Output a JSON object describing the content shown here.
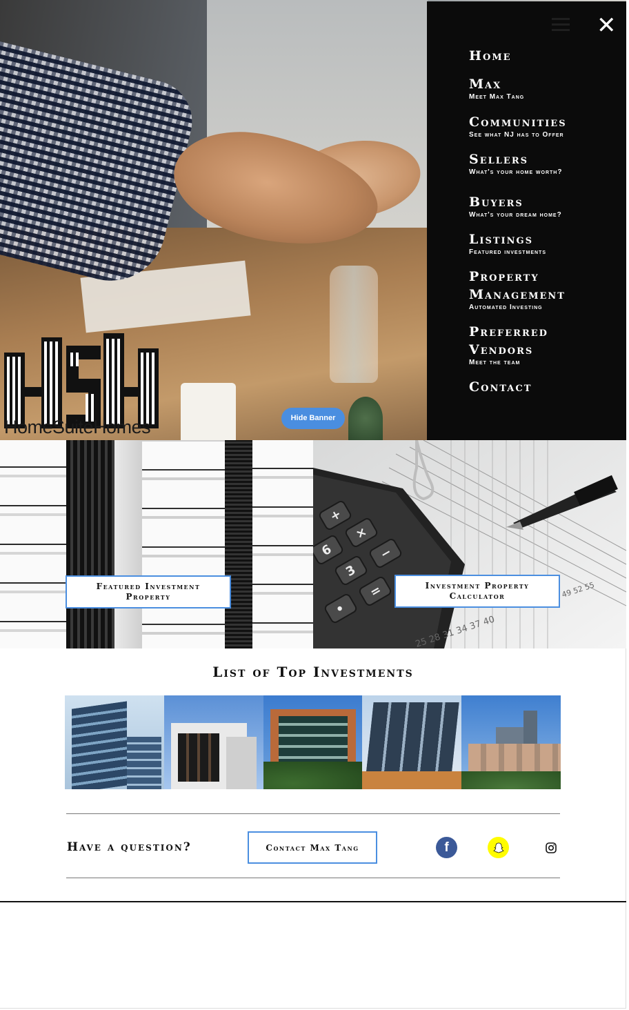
{
  "hero": {
    "logo_text": "HomeSuiteHomes",
    "hide_banner_label": "Hide Banner"
  },
  "menu": {
    "close_icon": "close-icon",
    "hamburger_icon": "hamburger-icon",
    "items": [
      {
        "label": "Home",
        "sub": ""
      },
      {
        "label": "Max",
        "sub": "Meet Max Tang"
      },
      {
        "label": "Communities",
        "sub": "See what NJ has to Offer"
      },
      {
        "label": "Sellers",
        "sub": "What's your home worth?"
      },
      {
        "label": "Buyers",
        "sub": "What's your dream home?"
      },
      {
        "label": "Listings",
        "sub": "Featured investments"
      },
      {
        "label": "Property Management",
        "sub": "Automated Investing"
      },
      {
        "label": "Preferred Vendors",
        "sub": "Meet the team"
      },
      {
        "label": "Contact",
        "sub": ""
      }
    ]
  },
  "tiles": {
    "featured_label": "Featured Investment Property",
    "calculator_label": "Investment Property Calculator",
    "calculator_scale_numbers": "25 28 31 34 37 40",
    "calculator_scale_numbers_upper": "49 52 55"
  },
  "list": {
    "title": "List of Top Investments"
  },
  "contact": {
    "question": "Have a question?",
    "button_label": "Contact Max Tang"
  },
  "social": {
    "facebook_icon": "facebook-icon",
    "facebook_glyph": "f",
    "snapchat_icon": "snapchat-icon",
    "instagram_icon": "instagram-icon",
    "facebook_color": "#3b5998",
    "snapchat_color": "#fffc00",
    "accent_color": "#4a8ee0"
  }
}
